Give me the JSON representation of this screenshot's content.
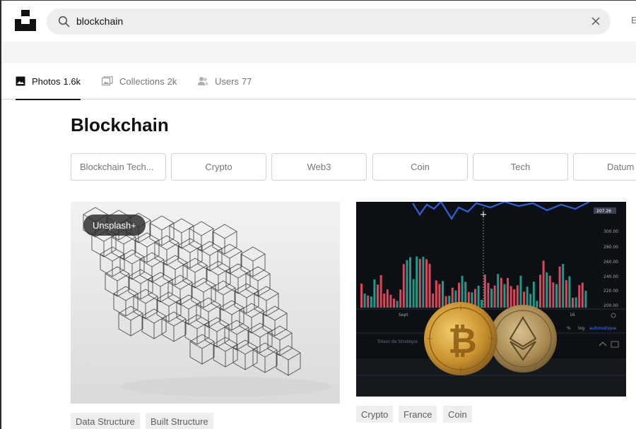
{
  "search": {
    "value": "blockchain"
  },
  "header": {
    "cut_text": "E"
  },
  "tabs": [
    {
      "label": "Photos",
      "count": "1.6k",
      "icon": "photo-icon",
      "active": true
    },
    {
      "label": "Collections",
      "count": "2k",
      "icon": "collections-icon",
      "active": false
    },
    {
      "label": "Users",
      "count": "77",
      "icon": "users-icon",
      "active": false
    }
  ],
  "page": {
    "title": "Blockchain"
  },
  "related": [
    "Blockchain Tech...",
    "Crypto",
    "Web3",
    "Coin",
    "Tech",
    "Datum"
  ],
  "photos": [
    {
      "badge": "Unsplash+",
      "tags": [
        "Data Structure",
        "Built Structure"
      ]
    },
    {
      "tags": [
        "Crypto",
        "France",
        "Coin"
      ]
    }
  ],
  "chart_labels": [
    "207.26",
    "300.00",
    "280.00",
    "260.00",
    "240.00",
    "220.00",
    "200.00",
    "Sept",
    "16",
    "%",
    "log",
    "automatique",
    "Trésor de Stratégie"
  ],
  "colors": {
    "active_tab": "#111111",
    "muted": "#767676",
    "chip_border": "#d1d1d1",
    "search_bg": "#eeeeee"
  }
}
